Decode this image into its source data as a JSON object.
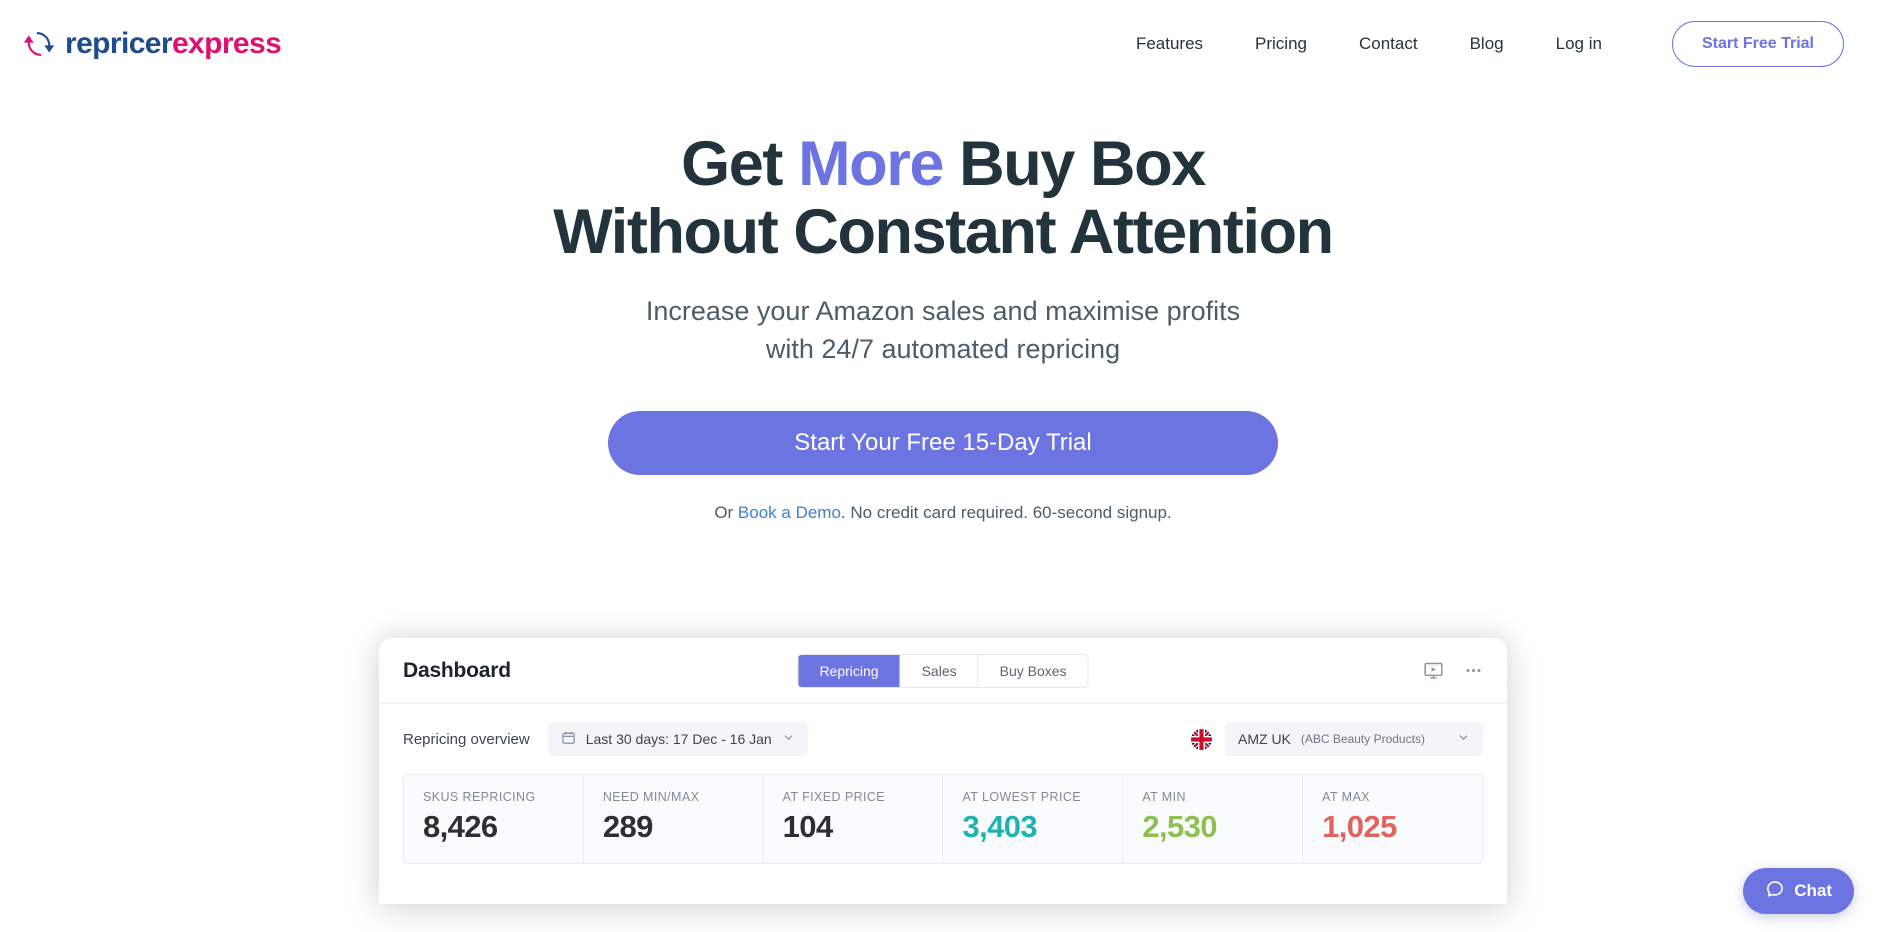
{
  "brand": {
    "word_primary": "repricer",
    "word_secondary": "express",
    "icon": "circular-refresh-icon",
    "color_primary": "#1e4c8f",
    "color_secondary": "#e0106f"
  },
  "nav": {
    "items": [
      {
        "label": "Features"
      },
      {
        "label": "Pricing"
      },
      {
        "label": "Contact"
      },
      {
        "label": "Blog"
      },
      {
        "label": "Log in"
      }
    ],
    "cta_label": "Start Free Trial",
    "cta_color": "#6b74e0"
  },
  "hero": {
    "title_line1_a": "Get ",
    "title_line1_accent": "More",
    "title_line1_b": " Buy Box",
    "title_line2": "Without Constant Attention",
    "accent_color": "#6b74e0",
    "subtitle_line1": "Increase your Amazon sales and maximise profits",
    "subtitle_line2": "with 24/7 automated repricing",
    "cta_label": "Start Your Free 15-Day Trial",
    "note_prefix": "Or ",
    "note_link": "Book a Demo",
    "note_suffix": ". No credit card required. 60-second signup."
  },
  "dashboard": {
    "title": "Dashboard",
    "tabs": [
      {
        "label": "Repricing",
        "active": true
      },
      {
        "label": "Sales",
        "active": false
      },
      {
        "label": "Buy Boxes",
        "active": false
      }
    ],
    "header_icons": [
      {
        "name": "video-tutorial-icon"
      },
      {
        "name": "more-options-icon"
      }
    ],
    "filter_label": "Repricing overview",
    "date_range": {
      "icon": "calendar-icon",
      "value": "Last 30 days: 17 Dec - 16 Jan",
      "chevron": "chevron-down-icon"
    },
    "marketplace": {
      "flag": "uk-flag-icon",
      "value": "AMZ UK",
      "value_sub": "(ABC Beauty Products)",
      "chevron": "chevron-down-icon"
    },
    "stats": [
      {
        "label": "SKUS REPRICING",
        "value": "8,426",
        "color": "#2b2f36"
      },
      {
        "label": "NEED MIN/MAX",
        "value": "289",
        "color": "#2b2f36"
      },
      {
        "label": "AT FIXED PRICE",
        "value": "104",
        "color": "#2b2f36"
      },
      {
        "label": "AT LOWEST PRICE",
        "value": "3,403",
        "color": "#1cb3b0"
      },
      {
        "label": "AT MIN",
        "value": "2,530",
        "color": "#8cc152"
      },
      {
        "label": "AT MAX",
        "value": "1,025",
        "color": "#e0635c"
      }
    ]
  },
  "chat": {
    "label": "Chat",
    "icon": "chat-bubble-icon",
    "color": "#6b74e0"
  }
}
